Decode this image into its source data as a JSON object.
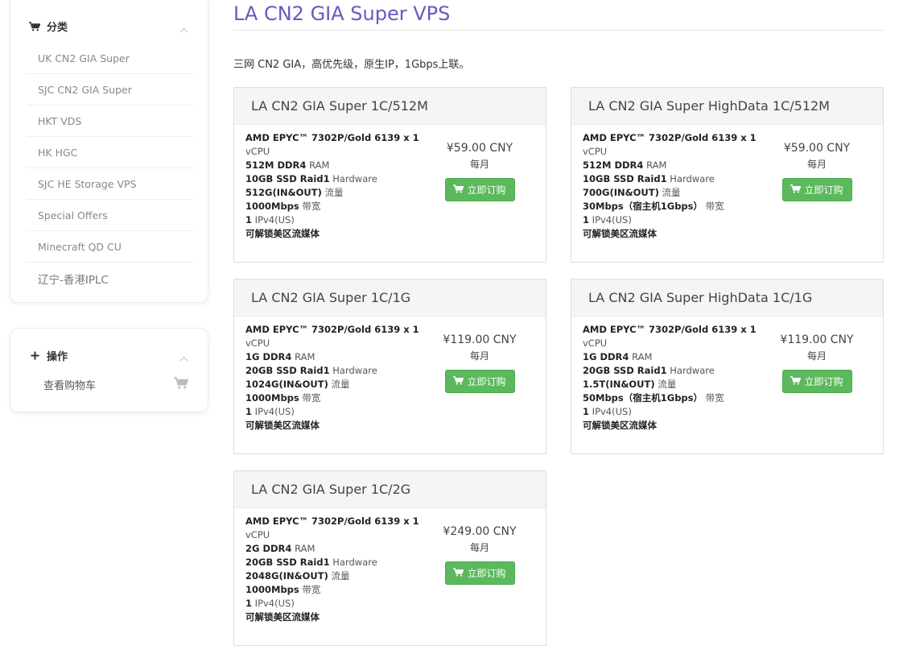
{
  "sidebar": {
    "categories_title": "分类",
    "categories": [
      "UK CN2 GIA Super",
      "SJC CN2 GIA Super",
      "HKT VDS",
      "HK HGC",
      "SJC HE Storage VPS",
      "Special Offers",
      "Minecraft QD CU",
      "辽宁-香港IPLC"
    ],
    "actions_title": "操作",
    "view_cart": "查看购物车"
  },
  "page": {
    "title": "LA CN2 GIA Super VPS",
    "description": "三网 CN2 GIA，高优先级，原生IP，1Gbps上联。"
  },
  "products": [
    {
      "name": "LA CN2 GIA Super 1C/512M",
      "cpu": "AMD EPYC™ 7302P/Gold 6139 x 1",
      "cpu_unit": "vCPU",
      "ram": "512M DDR4",
      "ram_unit": "RAM",
      "disk": "10GB SSD Raid1",
      "disk_unit": "Hardware",
      "traffic": "512G(IN&OUT)",
      "traffic_unit": "流量",
      "bandwidth": "1000Mbps",
      "bandwidth_unit": "带宽",
      "ip": "1",
      "ip_unit": "IPv4(US)",
      "streaming": "可解锁美区流媒体",
      "price": "¥59.00 CNY",
      "cycle": "每月",
      "order_label": "立即订购"
    },
    {
      "name": "LA CN2 GIA Super HighData 1C/512M",
      "cpu": "AMD EPYC™ 7302P/Gold 6139 x 1",
      "cpu_unit": "vCPU",
      "ram": "512M DDR4",
      "ram_unit": "RAM",
      "disk": "10GB SSD Raid1",
      "disk_unit": "Hardware",
      "traffic": "700G(IN&OUT)",
      "traffic_unit": "流量",
      "bandwidth": "30Mbps（宿主机1Gbps）",
      "bandwidth_unit": "带宽",
      "ip": "1",
      "ip_unit": "IPv4(US)",
      "streaming": "可解锁美区流媒体",
      "price": "¥59.00 CNY",
      "cycle": "每月",
      "order_label": "立即订购"
    },
    {
      "name": "LA CN2 GIA Super 1C/1G",
      "cpu": "AMD EPYC™ 7302P/Gold 6139 x 1",
      "cpu_unit": "vCPU",
      "ram": "1G DDR4",
      "ram_unit": "RAM",
      "disk": "20GB SSD Raid1",
      "disk_unit": "Hardware",
      "traffic": "1024G(IN&OUT)",
      "traffic_unit": "流量",
      "bandwidth": "1000Mbps",
      "bandwidth_unit": "带宽",
      "ip": "1",
      "ip_unit": "IPv4(US)",
      "streaming": "可解锁美区流媒体",
      "price": "¥119.00 CNY",
      "cycle": "每月",
      "order_label": "立即订购"
    },
    {
      "name": "LA CN2 GIA Super HighData 1C/1G",
      "cpu": "AMD EPYC™ 7302P/Gold 6139 x 1",
      "cpu_unit": "vCPU",
      "ram": "1G DDR4",
      "ram_unit": "RAM",
      "disk": "20GB SSD Raid1",
      "disk_unit": "Hardware",
      "traffic": "1.5T(IN&OUT)",
      "traffic_unit": "流量",
      "bandwidth": "50Mbps（宿主机1Gbps）",
      "bandwidth_unit": "带宽",
      "ip": "1",
      "ip_unit": "IPv4(US)",
      "streaming": "可解锁美区流媒体",
      "price": "¥119.00 CNY",
      "cycle": "每月",
      "order_label": "立即订购"
    },
    {
      "name": "LA CN2 GIA Super 1C/2G",
      "cpu": "AMD EPYC™ 7302P/Gold 6139 x 1",
      "cpu_unit": "vCPU",
      "ram": "2G DDR4",
      "ram_unit": "RAM",
      "disk": "20GB SSD Raid1",
      "disk_unit": "Hardware",
      "traffic": "2048G(IN&OUT)",
      "traffic_unit": "流量",
      "bandwidth": "1000Mbps",
      "bandwidth_unit": "带宽",
      "ip": "1",
      "ip_unit": "IPv4(US)",
      "streaming": "可解锁美区流媒体",
      "price": "¥249.00 CNY",
      "cycle": "每月",
      "order_label": "立即订购"
    }
  ],
  "colors": {
    "accent": "#6f55c3",
    "order_button": "#5cb85c"
  },
  "icons": {
    "categories": "cart-icon",
    "actions": "plus-icon",
    "view_cart": "cart-icon",
    "collapse": "chevron-up-icon"
  }
}
